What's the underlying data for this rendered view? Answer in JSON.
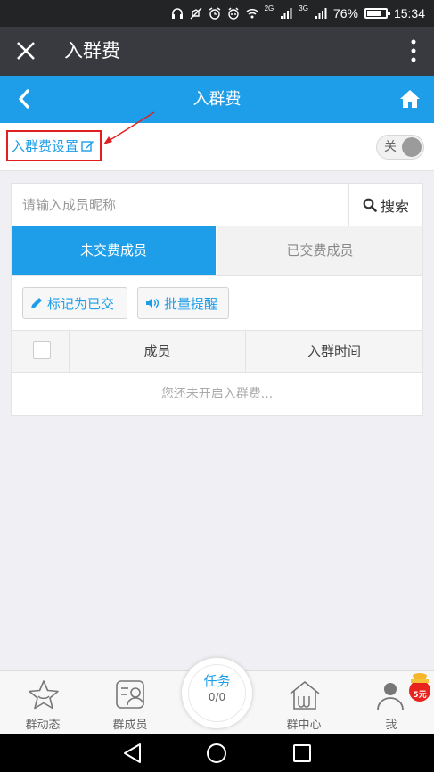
{
  "status_bar": {
    "net1": "2G",
    "net2": "3G",
    "battery": "76%",
    "time": "15:34"
  },
  "wechat_bar": {
    "title": "入群费"
  },
  "page_header": {
    "title": "入群费"
  },
  "settings": {
    "fee_setting_label": "入群费设置",
    "toggle_label": "关",
    "toggle_on": false
  },
  "search": {
    "placeholder": "请输入成员昵称",
    "button_label": "搜索"
  },
  "tabs": [
    {
      "label": "未交费成员",
      "active": true
    },
    {
      "label": "已交费成员",
      "active": false
    }
  ],
  "actions": {
    "mark_paid": "标记为已交",
    "batch_remind": "批量提醒"
  },
  "table": {
    "columns": [
      "成员",
      "入群时间"
    ],
    "empty_message": "您还未开启入群费..."
  },
  "bottom_nav": {
    "items": [
      {
        "label": "群动态",
        "icon": "star-icon"
      },
      {
        "label": "群成员",
        "icon": "members-icon"
      },
      {
        "label": "群中心",
        "icon": "home-center-icon"
      },
      {
        "label": "我",
        "icon": "person-icon"
      }
    ],
    "task": {
      "label": "任务",
      "count": "0/0"
    },
    "gift_badge": "5元"
  },
  "colors": {
    "accent": "#1e9ee8",
    "highlight_red": "#e02020",
    "wechat_bar": "#393a3f"
  }
}
